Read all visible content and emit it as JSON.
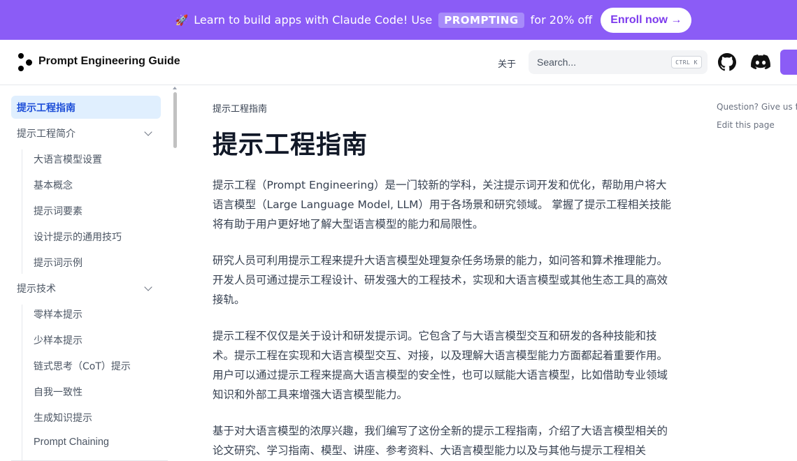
{
  "banner": {
    "rocket": "🚀",
    "text_before": "Learn to build apps with Claude Code! Use",
    "code": "PROMPTING",
    "text_after": "for 20% off",
    "cta": "Enroll now →",
    "bg_color": "#8b5cf6"
  },
  "header": {
    "site_title": "Prompt Engineering Guide",
    "about": "关于",
    "search_placeholder": "Search...",
    "search_shortcut": "CTRL K"
  },
  "sidebar": {
    "active": "提示工程指南",
    "sections": [
      {
        "label": "提示工程简介",
        "items": [
          "大语言模型设置",
          "基本概念",
          "提示词要素",
          "设计提示的通用技巧",
          "提示词示例"
        ]
      },
      {
        "label": "提示技术",
        "items": [
          "零样本提示",
          "少样本提示",
          "链式思考（CoT）提示",
          "自我一致性",
          "生成知识提示",
          "Prompt Chaining"
        ]
      }
    ]
  },
  "main": {
    "breadcrumb": "提示工程指南",
    "title": "提示工程指南",
    "paragraphs": [
      "提示工程（Prompt Engineering）是一门较新的学科，关注提示词开发和优化，帮助用户将大语言模型（Large Language Model, LLM）用于各场景和研究领域。 掌握了提示工程相关技能将有助于用户更好地了解大型语言模型的能力和局限性。",
      "研究人员可利用提示工程来提升大语言模型处理复杂任务场景的能力，如问答和算术推理能力。开发人员可通过提示工程设计、研发强大的工程技术，实现和大语言模型或其他生态工具的高效接轨。",
      "提示工程不仅仅是关于设计和研发提示词。它包含了与大语言模型交互和研发的各种技能和技术。提示工程在实现和大语言模型交互、对接，以及理解大语言模型能力方面都起着重要作用。用户可以通过提示工程来提高大语言模型的安全性，也可以赋能大语言模型，比如借助专业领域知识和外部工具来增强大语言模型能力。",
      "基于对大语言模型的浓厚兴趣，我们编写了这份全新的提示工程指南，介绍了大语言模型相关的论文研究、学习指南、模型、讲座、参考资料、大语言模型能力以及与其他与提示工程相关"
    ]
  },
  "toc": {
    "feedback": "Question? Give us feedback →",
    "edit": "Edit this page"
  }
}
